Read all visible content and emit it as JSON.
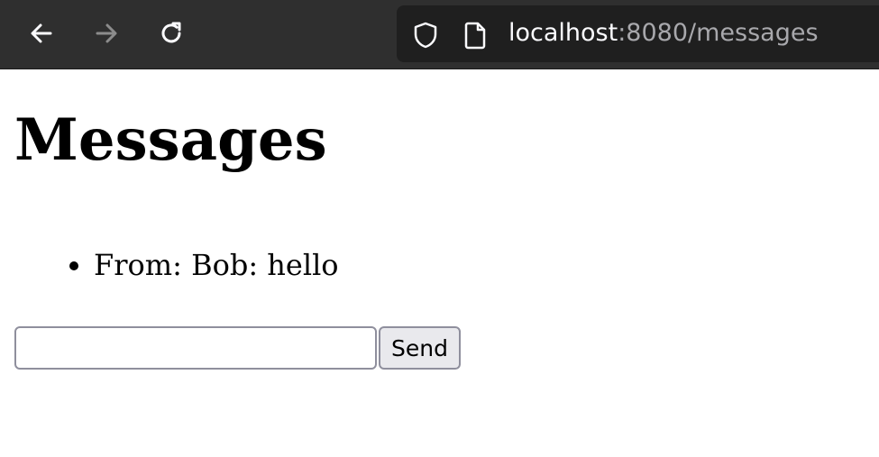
{
  "browser": {
    "url_host": "localhost",
    "url_path": ":8080/messages"
  },
  "page": {
    "title": "Messages",
    "messages": [
      "From: Bob: hello"
    ],
    "input_value": "",
    "send_label": "Send"
  },
  "icons": {
    "back": "arrow-left-icon",
    "forward": "arrow-right-icon",
    "reload": "reload-icon",
    "security": "shield-icon",
    "page": "page-icon"
  },
  "colors": {
    "toolbar_bg": "#2f2f2f",
    "urlbar_bg": "#1f1f1f",
    "url_host": "#fbfbfe",
    "url_path": "#a8a8ac",
    "button_bg": "#e9e9ed"
  }
}
